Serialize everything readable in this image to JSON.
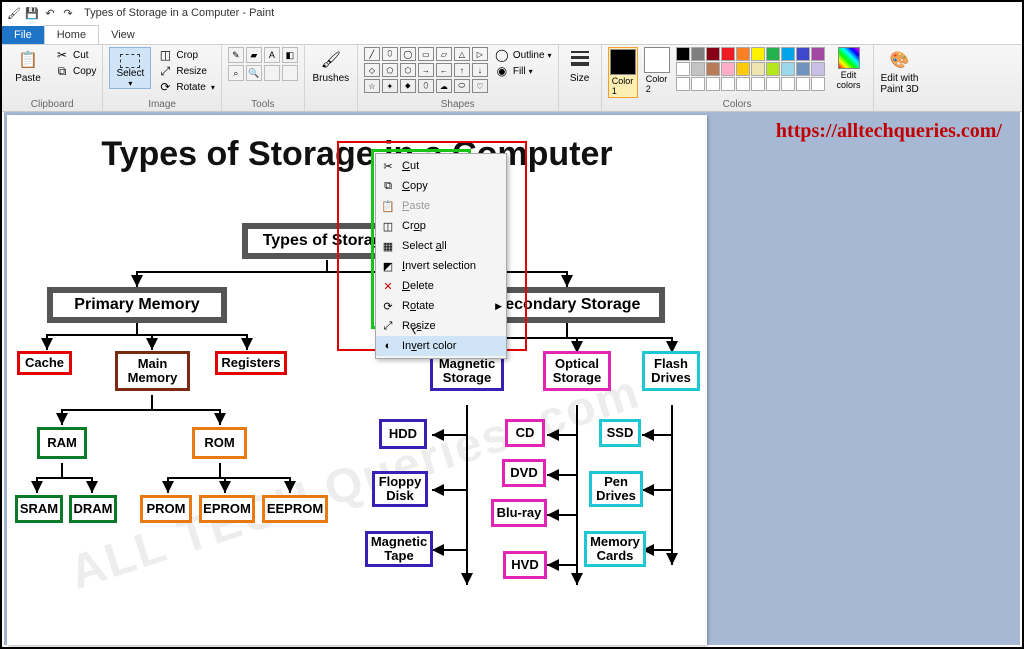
{
  "title": "Types of Storage in a Computer - Paint",
  "tabs": {
    "file": "File",
    "home": "Home",
    "view": "View"
  },
  "ribbon": {
    "clipboard": {
      "paste": "Paste",
      "cut": "Cut",
      "copy": "Copy",
      "label": "Clipboard"
    },
    "image": {
      "select": "Select",
      "crop": "Crop",
      "resize": "Resize",
      "rotate": "Rotate",
      "label": "Image"
    },
    "tools": {
      "label": "Tools"
    },
    "brushes": {
      "brushes": "Brushes"
    },
    "shapes": {
      "outline": "Outline",
      "fill": "Fill",
      "label": "Shapes"
    },
    "size": {
      "size": "Size"
    },
    "colors": {
      "c1": "Color\n1",
      "c2": "Color\n2",
      "edit": "Edit\ncolors",
      "label": "Colors"
    },
    "p3d": {
      "label": "Edit with\nPaint 3D"
    }
  },
  "palette_row1": [
    "#000000",
    "#7f7f7f",
    "#880015",
    "#ed1c24",
    "#ff7f27",
    "#fff200",
    "#22b14c",
    "#00a2e8",
    "#3f48cc",
    "#a349a4"
  ],
  "palette_row2": [
    "#ffffff",
    "#c3c3c3",
    "#b97a57",
    "#ffaec9",
    "#ffc90e",
    "#efe4b0",
    "#b5e61d",
    "#99d9ea",
    "#7092be",
    "#c8bfe7"
  ],
  "doc": {
    "title": "Types of Storage in a Computer",
    "watermark": "ALL TECH Queries .com",
    "nodes": {
      "root": "Types of Storage",
      "primary": "Primary Memory",
      "secondary": "Secondary Storage",
      "cache": "Cache",
      "mainmem": "Main Memory",
      "registers": "Registers",
      "ram": "RAM",
      "rom": "ROM",
      "sram": "SRAM",
      "dram": "DRAM",
      "prom": "PROM",
      "eprom": "EPROM",
      "eeprom": "EEPROM",
      "magstor": "Magnetic Storage",
      "optstor": "Optical Storage",
      "flash": "Flash Drives",
      "hdd": "HDD",
      "floppy": "Floppy Disk",
      "magtape": "Magnetic Tape",
      "cd": "CD",
      "dvd": "DVD",
      "bluray": "Blu-ray",
      "hvd": "HVD",
      "ssd": "SSD",
      "pendrives": "Pen Drives",
      "memcards": "Memory Cards"
    }
  },
  "ctx": {
    "cut": "Cut",
    "copy": "Copy",
    "paste": "Paste",
    "crop": "Crop",
    "selectall": "Select all",
    "invert": "Invert selection",
    "delete": "Delete",
    "rotate": "Rotate",
    "resize": "Resize",
    "invcolor": "Invert color"
  },
  "overlay_url": "https://alltechqueries.com/"
}
